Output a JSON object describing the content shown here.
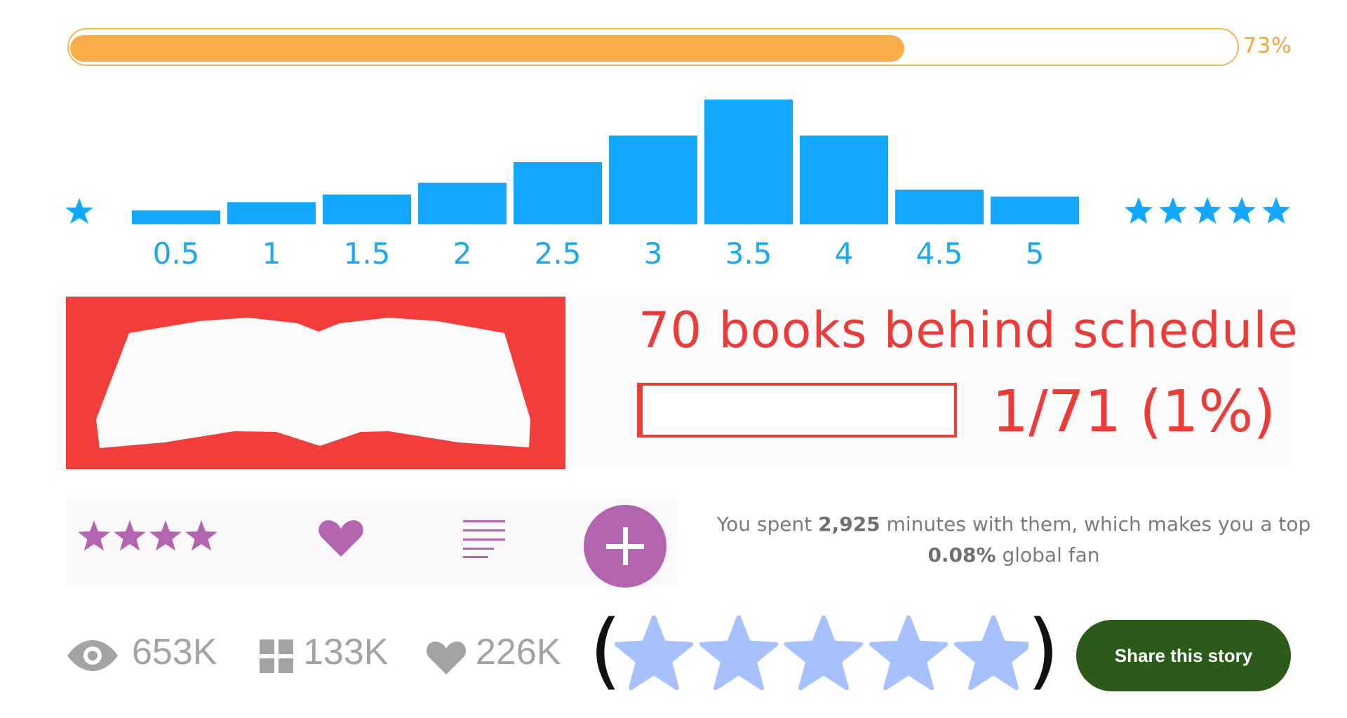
{
  "progress": {
    "percent": 73,
    "label": "73%"
  },
  "chart_data": {
    "type": "bar",
    "categories": [
      "0.5",
      "1",
      "1.5",
      "2",
      "2.5",
      "3",
      "3.5",
      "4",
      "4.5",
      "5"
    ],
    "values": [
      2,
      3.2,
      4.3,
      6,
      9,
      12.8,
      18,
      12.8,
      5,
      4
    ],
    "ylim": [
      0,
      18
    ]
  },
  "schedule": {
    "title": "70 books behind schedule",
    "progress_text": "1/71 (1%)",
    "percent": 1
  },
  "actions": {
    "shelf_rating": 4,
    "stats_prefix": "You spent ",
    "minutes": "2,925",
    "stats_middle": " minutes with them, which makes you a top ",
    "percentile": "0.08%",
    "stats_suffix": " global fan"
  },
  "counts": {
    "views": "653K",
    "adds": "133K",
    "likes": "226K"
  },
  "rating_stars": 5,
  "share": {
    "label": "Share this story"
  },
  "colors": {
    "progress": "#f9ae4a",
    "histogram": "#13a8ff",
    "schedule": "#ee3b37",
    "actions": "#b464ae",
    "stars": "#a7c1ff",
    "share": "#2b5a1b"
  }
}
